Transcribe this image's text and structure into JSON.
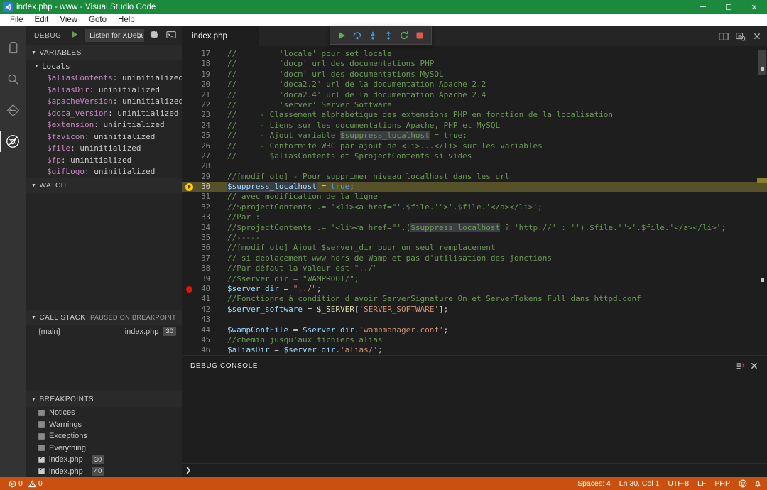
{
  "window": {
    "title": "index.php - www - Visual Studio Code",
    "icon": "vscode-logo-icon",
    "minimize": "─",
    "maximize": "☐",
    "close": "✕"
  },
  "menubar": {
    "items": [
      "File",
      "Edit",
      "View",
      "Goto",
      "Help"
    ]
  },
  "activitybar": {
    "items": [
      {
        "name": "explorer-icon",
        "label": "Explorer",
        "active": false
      },
      {
        "name": "search-icon",
        "label": "Search",
        "active": false
      },
      {
        "name": "source-control-icon",
        "label": "Source Control",
        "active": false
      },
      {
        "name": "debug-icon",
        "label": "Debug",
        "active": true
      }
    ]
  },
  "sidebar": {
    "header": {
      "title": "DEBUG",
      "start_icon": "play-icon",
      "configuration": "Listen for XDebu",
      "caret": "▾",
      "gear_icon": "gear-icon",
      "console_icon": "open-console-icon"
    },
    "variables": {
      "title": "VARIABLES",
      "scope": "Locals",
      "items": [
        {
          "name": "$aliasContents",
          "value": "uninitialized"
        },
        {
          "name": "$aliasDir",
          "value": "uninitialized"
        },
        {
          "name": "$apacheVersion",
          "value": "uninitialized"
        },
        {
          "name": "$doca_version",
          "value": "uninitialized"
        },
        {
          "name": "$extension",
          "value": "uninitialized"
        },
        {
          "name": "$favicon",
          "value": "uninitialized"
        },
        {
          "name": "$file",
          "value": "uninitialized"
        },
        {
          "name": "$fp",
          "value": "uninitialized"
        },
        {
          "name": "$gifLogo",
          "value": "uninitialized"
        }
      ]
    },
    "watch": {
      "title": "WATCH",
      "items": []
    },
    "callstack": {
      "title": "CALL STACK",
      "status": "PAUSED ON BREAKPOINT",
      "frames": [
        {
          "name": "{main}",
          "file": "index.php",
          "line": "30"
        }
      ]
    },
    "breakpoints": {
      "title": "BREAKPOINTS",
      "items": [
        {
          "label": "Notices",
          "checked": false,
          "line": ""
        },
        {
          "label": "Warnings",
          "checked": false,
          "line": ""
        },
        {
          "label": "Exceptions",
          "checked": false,
          "line": ""
        },
        {
          "label": "Everything",
          "checked": false,
          "line": ""
        },
        {
          "label": "index.php",
          "checked": true,
          "line": "30"
        },
        {
          "label": "index.php",
          "checked": true,
          "line": "40"
        }
      ]
    }
  },
  "editor": {
    "tab": {
      "label": "index.php",
      "dirty": false
    },
    "actions": [
      {
        "name": "split-editor-icon",
        "label": "Split Editor"
      },
      {
        "name": "open-changes-icon",
        "label": "Open Changes"
      },
      {
        "name": "close-editor-icon",
        "label": "Close"
      }
    ],
    "debug_toolbar": [
      {
        "name": "continue-button",
        "label": "Continue"
      },
      {
        "name": "step-over-button",
        "label": "Step Over"
      },
      {
        "name": "step-into-button",
        "label": "Step Into"
      },
      {
        "name": "step-out-button",
        "label": "Step Out"
      },
      {
        "name": "restart-button",
        "label": "Restart"
      },
      {
        "name": "stop-button",
        "label": "Stop"
      }
    ],
    "current_line": 30,
    "breakpoint_lines": [
      30,
      40
    ],
    "lines": [
      {
        "n": 17,
        "segs": [
          [
            "c-com",
            "//         'locale' pour set_locale"
          ]
        ]
      },
      {
        "n": 18,
        "segs": [
          [
            "c-com",
            "//         'docp' url des documentations PHP"
          ]
        ]
      },
      {
        "n": 19,
        "segs": [
          [
            "c-com",
            "//         'docm' url des documentations MySQL"
          ]
        ]
      },
      {
        "n": 20,
        "segs": [
          [
            "c-com",
            "//         'doca2.2' url de la documentation Apache 2.2"
          ]
        ]
      },
      {
        "n": 21,
        "segs": [
          [
            "c-com",
            "//         'doca2.4' url de la documentation Apache 2.4"
          ]
        ]
      },
      {
        "n": 22,
        "segs": [
          [
            "c-com",
            "//         'server' Server Software"
          ]
        ]
      },
      {
        "n": 23,
        "segs": [
          [
            "c-com",
            "//     - Classement alphabétique des extensions PHP en fonction de la localisation"
          ]
        ]
      },
      {
        "n": 24,
        "segs": [
          [
            "c-com",
            "//     - Liens sur les documentations Apache, PHP et MySQL"
          ]
        ]
      },
      {
        "n": 25,
        "segs": [
          [
            "c-com",
            "//     - Ajout variable "
          ],
          [
            "c-com sel",
            "$suppress_localhost"
          ],
          [
            "c-com",
            " = true;"
          ]
        ]
      },
      {
        "n": 26,
        "segs": [
          [
            "c-com",
            "//     - Conformité W3C par ajout de <li>...</li> sur les variables"
          ]
        ]
      },
      {
        "n": 27,
        "segs": [
          [
            "c-com",
            "//       $aliasContents et $projectContents si vides"
          ]
        ]
      },
      {
        "n": 28,
        "segs": [
          [
            "c-txt",
            ""
          ]
        ]
      },
      {
        "n": 29,
        "segs": [
          [
            "c-com",
            "//[modif oto] - Pour supprimer niveau localhost dans les url"
          ]
        ]
      },
      {
        "n": 30,
        "segs": [
          [
            "c-var sel",
            "$suppress_localhost"
          ],
          [
            "c-txt",
            " = "
          ],
          [
            "c-kw",
            "true"
          ],
          [
            "c-txt",
            ";"
          ]
        ]
      },
      {
        "n": 31,
        "segs": [
          [
            "c-com",
            "// avec modification de la ligne"
          ]
        ]
      },
      {
        "n": 32,
        "segs": [
          [
            "c-com",
            "//$projectContents .= '<li><a href=\"'.$file.'\">'.$file.'</a></li>';"
          ]
        ]
      },
      {
        "n": 33,
        "segs": [
          [
            "c-com",
            "//Par :"
          ]
        ]
      },
      {
        "n": 34,
        "segs": [
          [
            "c-com",
            "//$projectContents .= '<li><a href=\"'.("
          ],
          [
            "c-com sel",
            "$suppress_localhost"
          ],
          [
            "c-com",
            " ? 'http://' : '').$file.'\">'.$file.'</a></li>';"
          ]
        ]
      },
      {
        "n": 35,
        "segs": [
          [
            "c-com",
            "//-----"
          ]
        ]
      },
      {
        "n": 36,
        "segs": [
          [
            "c-com",
            "//[modif oto] Ajout $server_dir pour un seul remplacement"
          ]
        ]
      },
      {
        "n": 37,
        "segs": [
          [
            "c-com",
            "// si deplacement www hors de Wamp et pas d'utilisation des jonctions"
          ]
        ]
      },
      {
        "n": 38,
        "segs": [
          [
            "c-com",
            "//Par défaut la valeur est \"../\""
          ]
        ]
      },
      {
        "n": 39,
        "segs": [
          [
            "c-com",
            "//$server_dir = \"WAMPROOT/\";"
          ]
        ]
      },
      {
        "n": 40,
        "segs": [
          [
            "c-var",
            "$server_dir"
          ],
          [
            "c-txt",
            " = "
          ],
          [
            "c-str",
            "\"../\""
          ],
          [
            "c-txt",
            ";"
          ]
        ]
      },
      {
        "n": 41,
        "segs": [
          [
            "c-com",
            "//Fonctionne à condition d'avoir ServerSignature On et ServerTokens Full dans httpd.conf"
          ]
        ]
      },
      {
        "n": 42,
        "segs": [
          [
            "c-var",
            "$server_software"
          ],
          [
            "c-txt",
            " = "
          ],
          [
            "c-fn",
            "$_SERVER"
          ],
          [
            "c-txt",
            "["
          ],
          [
            "c-str",
            "'SERVER_SOFTWARE'"
          ],
          [
            "c-txt",
            "];"
          ]
        ]
      },
      {
        "n": 43,
        "segs": [
          [
            "c-txt",
            ""
          ]
        ]
      },
      {
        "n": 44,
        "segs": [
          [
            "c-var",
            "$wampConfFile"
          ],
          [
            "c-txt",
            " = "
          ],
          [
            "c-var",
            "$server_dir"
          ],
          [
            "c-txt",
            "."
          ],
          [
            "c-str",
            "'wampmanager.conf'"
          ],
          [
            "c-txt",
            ";"
          ]
        ]
      },
      {
        "n": 45,
        "segs": [
          [
            "c-com",
            "//chemin jusqu'aux fichiers alias"
          ]
        ]
      },
      {
        "n": 46,
        "segs": [
          [
            "c-var",
            "$aliasDir"
          ],
          [
            "c-txt",
            " = "
          ],
          [
            "c-var",
            "$server_dir"
          ],
          [
            "c-txt",
            "."
          ],
          [
            "c-str",
            "'alias/'"
          ],
          [
            "c-txt",
            ";"
          ]
        ]
      },
      {
        "n": 47,
        "segs": [
          [
            "c-txt",
            ""
          ]
        ]
      }
    ]
  },
  "panel": {
    "title": "DEBUG CONSOLE",
    "clear_icon": "clear-console-icon",
    "close_icon": "close-panel-icon",
    "prompt_caret": "❯",
    "content": ""
  },
  "statusbar": {
    "errors_icon": "error-icon",
    "errors": "0",
    "warnings_icon": "warning-icon",
    "warnings": "0",
    "right_items": [
      {
        "name": "indentation-status",
        "label": "Spaces: 4"
      },
      {
        "name": "cursor-position-status",
        "label": "Ln 30, Col 1"
      },
      {
        "name": "encoding-status",
        "label": "UTF-8"
      },
      {
        "name": "eol-status",
        "label": "LF"
      },
      {
        "name": "language-mode-status",
        "label": "PHP"
      }
    ],
    "feedback_icon": "smiley-icon",
    "bell_icon": "bell-icon"
  },
  "colors": {
    "titlebar": "#1b8a3c",
    "statusbar": "#ca5010",
    "accent_current_line": "#57512a",
    "breakpoint": "#e51400",
    "debug_arrow": "#ffcc00"
  }
}
